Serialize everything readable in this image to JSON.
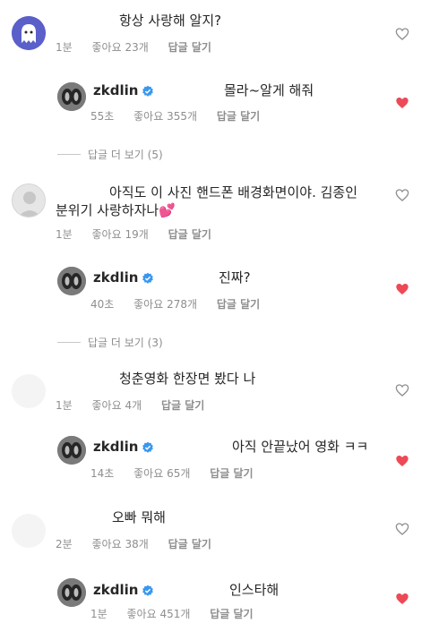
{
  "comments": [
    {
      "text": "항상 사랑해 알지?",
      "time": "1분",
      "likes": "좋아요 23개",
      "reply": "답글 달기",
      "avatar_icon": "ghost-avatar-icon",
      "liked": false,
      "replies": [
        {
          "username": "zkdlin",
          "verified": true,
          "text": "몰라~알게 해줘",
          "time": "55초",
          "likes": "좋아요 355개",
          "reply": "답글 달기",
          "liked": true
        }
      ],
      "more_replies": "답글 더 보기 (5)"
    },
    {
      "text_line1": "아직도 이 사진 핸드폰 배경화면이야. 김종인",
      "text_line2": "분위기 사랑하자나💕",
      "time": "1분",
      "likes": "좋아요 19개",
      "reply": "답글 달기",
      "avatar_icon": "default-avatar-icon",
      "liked": false,
      "replies": [
        {
          "username": "zkdlin",
          "verified": true,
          "text": "진짜?",
          "time": "40초",
          "likes": "좋아요 278개",
          "reply": "답글 달기",
          "liked": true
        }
      ],
      "more_replies": "답글 더 보기 (3)"
    },
    {
      "text": "청춘영화 한장면 봤다 나",
      "time": "1분",
      "likes": "좋아요 4개",
      "reply": "답글 달기",
      "liked": false,
      "replies": [
        {
          "username": "zkdlin",
          "verified": true,
          "text": "아직 안끝났어 영화 ㅋㅋ",
          "time": "14초",
          "likes": "좋아요 65개",
          "reply": "답글 달기",
          "liked": true
        }
      ]
    },
    {
      "text": "오빠 뭐해",
      "time": "2분",
      "likes": "좋아요 38개",
      "reply": "답글 달기",
      "liked": false,
      "replies": [
        {
          "username": "zkdlin",
          "verified": true,
          "text": "인스타해",
          "time": "1분",
          "likes": "좋아요 451개",
          "reply": "답글 달기",
          "liked": true
        }
      ]
    }
  ],
  "colors": {
    "heart_liked": "#ed4956",
    "heart_empty": "#8e8e8e",
    "verified": "#3897f0"
  }
}
